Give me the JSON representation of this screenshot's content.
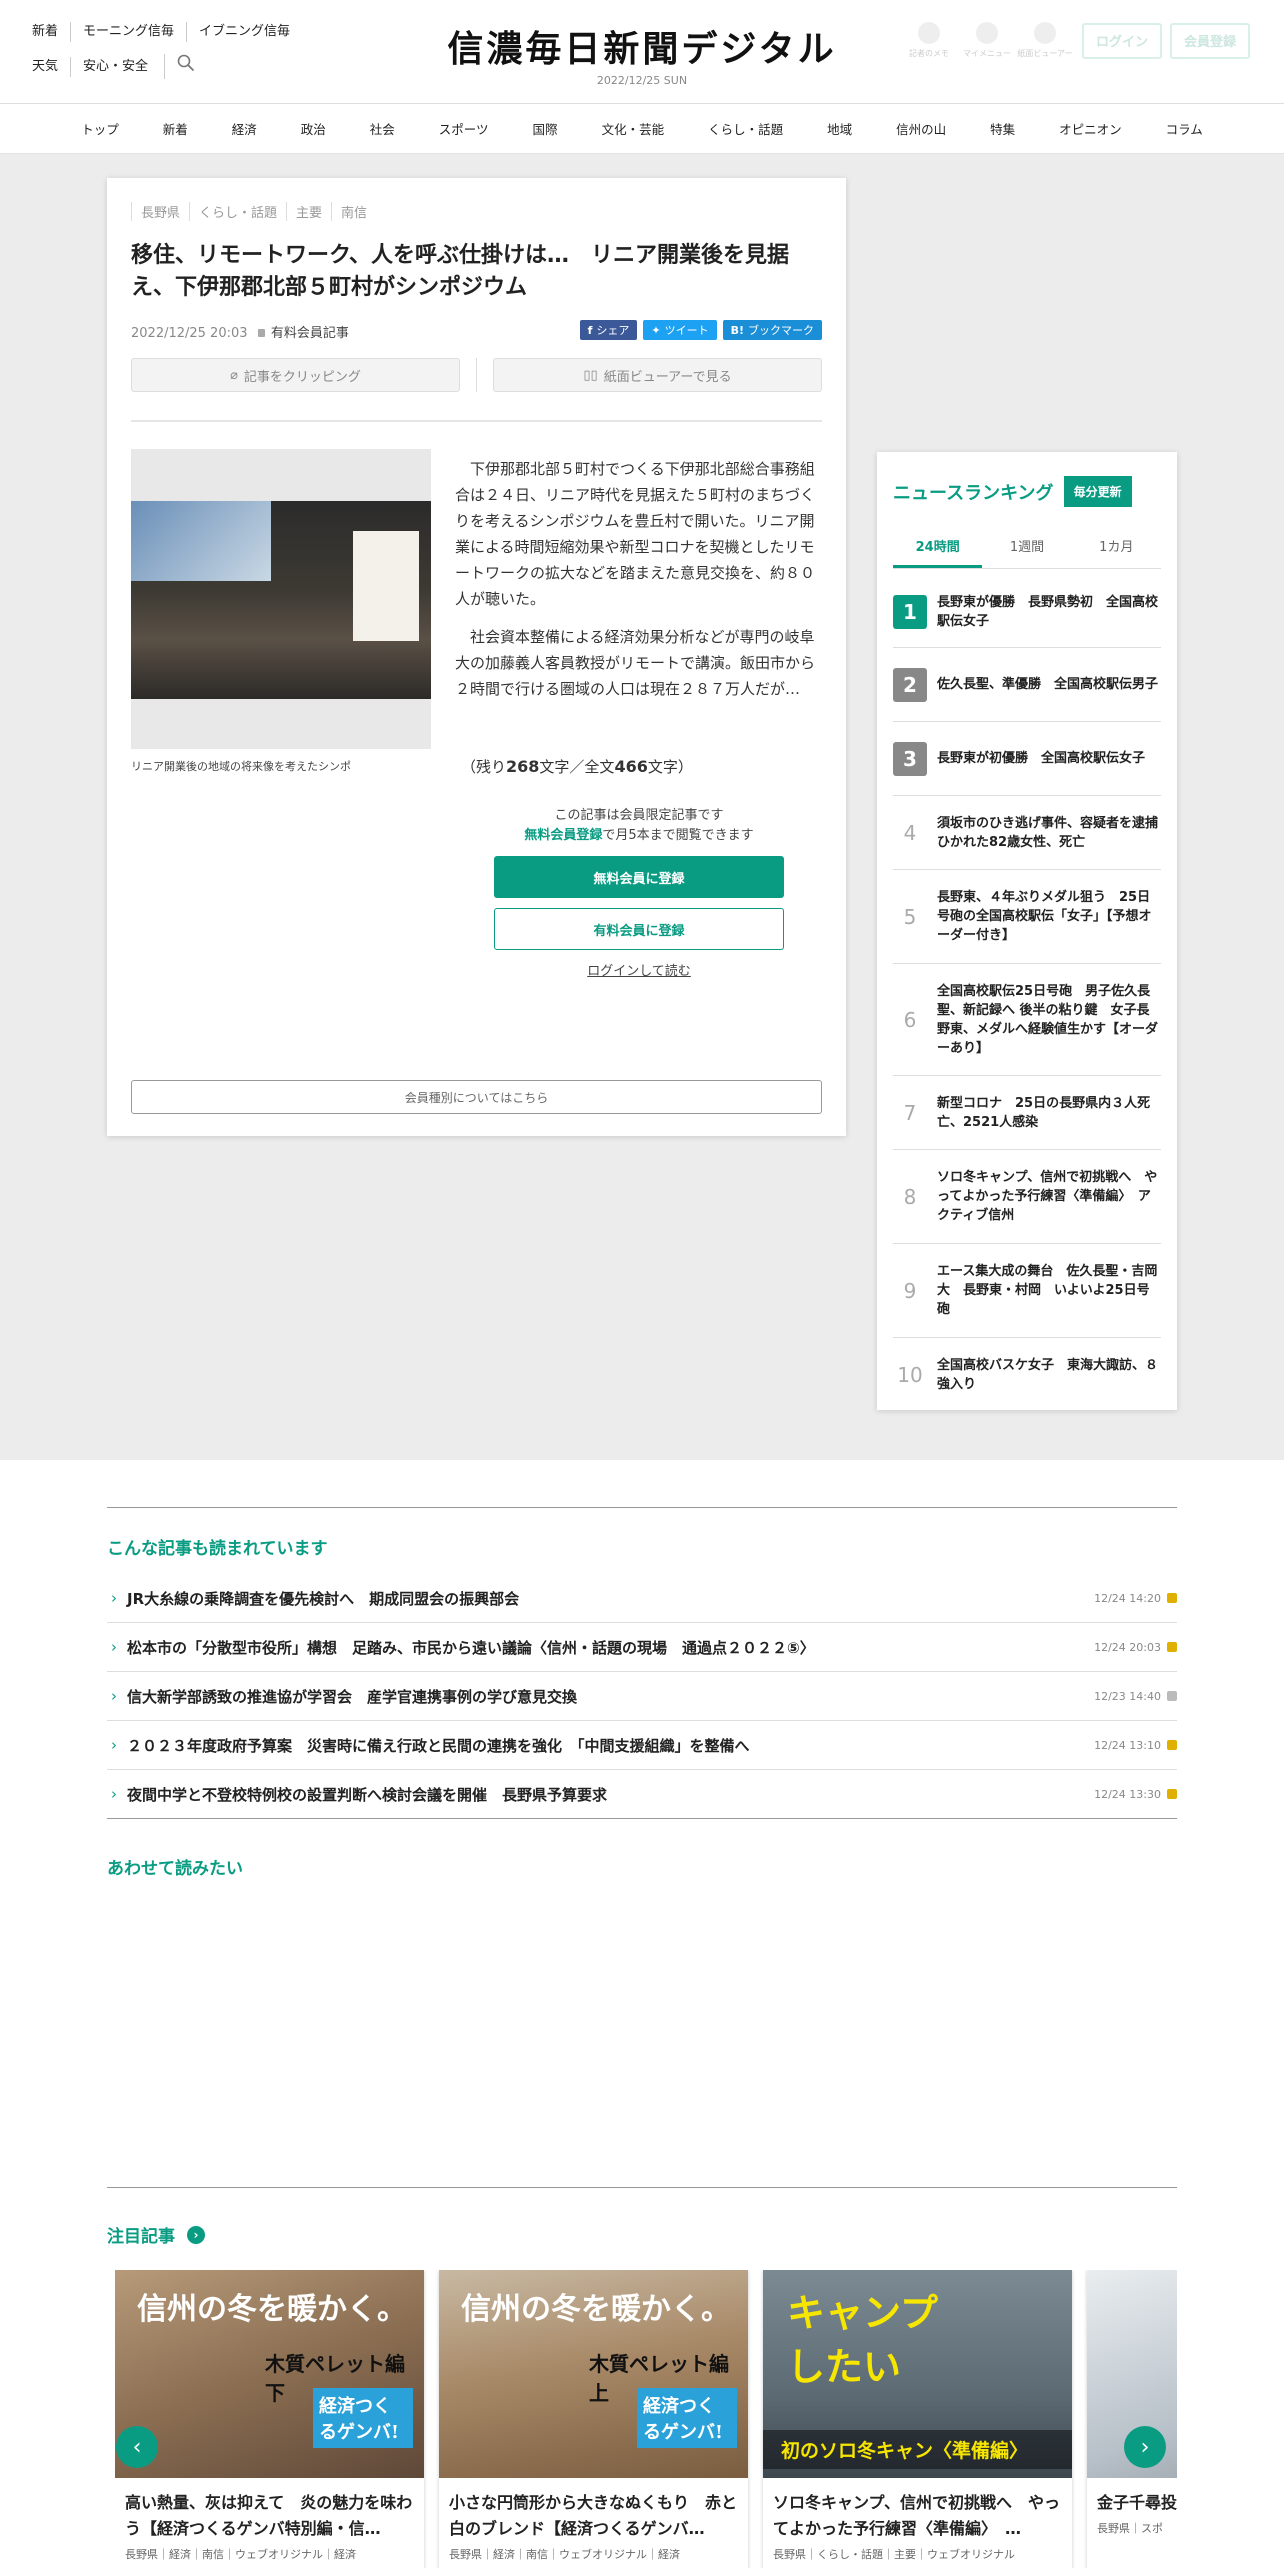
{
  "header": {
    "links_row1": [
      "新着",
      "モーニング信毎",
      "イブニング信毎"
    ],
    "links_row2": [
      "天気",
      "安心・安全"
    ],
    "logo": "信濃毎日新聞デジタル",
    "date": "2022/12/25 SUN",
    "icons": [
      "記者のメモ",
      "マイメニュー",
      "紙面ビューアー"
    ],
    "login": "ログイン",
    "register": "会員登録"
  },
  "nav": [
    "トップ",
    "新着",
    "経済",
    "政治",
    "社会",
    "スポーツ",
    "国際",
    "文化・芸能",
    "くらし・話題",
    "地域",
    "信州の山",
    "特集",
    "オピニオン",
    "コラム"
  ],
  "article": {
    "tags": [
      "長野県",
      "くらし・話題",
      "主要",
      "南信"
    ],
    "title": "移住、リモートワーク、人を呼ぶ仕掛けは…　リニア開業後を見据え、下伊那郡北部５町村がシンポジウム",
    "datetime": "2022/12/25 20:03",
    "paid_label": "有料会員記事",
    "share": "シェア",
    "tweet": "ツイート",
    "bookmark": "ブックマーク",
    "clip": "記事をクリッピング",
    "viewer": "紙面ビューアーで見る",
    "caption": "リニア開業後の地域の将来像を考えたシンポ",
    "p1": "下伊那郡北部５町村でつくる下伊那北部総合事務組合は２４日、リニア時代を見据えた５町村のまちづくりを考えるシンポジウムを豊丘村で開いた。リニア開業による時間短縮効果や新型コロナを契機としたリモートワークの拡大などを踏まえた意見交換を、約８０人が聴いた。",
    "p2": "社会資本整備による経済効果分析などが専門の岐阜大の加藤義人客員教授がリモートで講演。飯田市から２時間で行ける圏域の人口は現在２８７万人だが…",
    "remain_pre": "（残り",
    "remain_n": "268",
    "remain_mid": "文字／全文",
    "total_n": "466",
    "remain_post": "文字）",
    "lock1": "この記事は会員限定記事です",
    "lock2a": "無料会員登録",
    "lock2b": "で月5本まで閲覧できます",
    "btn_free": "無料会員に登録",
    "btn_paid": "有料会員に登録",
    "login_read": "ログインして読む",
    "member_types": "会員種別についてはこちら"
  },
  "ranking": {
    "title": "ニュースランキング",
    "badge": "毎分更新",
    "tabs": [
      "24時間",
      "1週間",
      "1カ月"
    ],
    "items": [
      {
        "n": "1",
        "t": "長野東が優勝　長野県勢初　全国高校駅伝女子"
      },
      {
        "n": "2",
        "t": "佐久長聖、準優勝　全国高校駅伝男子"
      },
      {
        "n": "3",
        "t": "長野東が初優勝　全国高校駅伝女子"
      },
      {
        "n": "4",
        "t": "須坂市のひき逃げ事件、容疑者を逮捕　ひかれた82歳女性、死亡"
      },
      {
        "n": "5",
        "t": "長野東、４年ぶりメダル狙う　25日号砲の全国高校駅伝「女子」【予想オーダー付き】"
      },
      {
        "n": "6",
        "t": "全国高校駅伝25日号砲　男子佐久長聖、新記録へ 後半の粘り鍵　女子長野東、メダルへ経験値生かす【オーダーあり】"
      },
      {
        "n": "7",
        "t": "新型コロナ　25日の長野県内３人死亡、2521人感染"
      },
      {
        "n": "8",
        "t": "ソロ冬キャンプ、信州で初挑戦へ　やってよかった予行練習〈準備編〉　アクティブ信州"
      },
      {
        "n": "9",
        "t": "エース集大成の舞台　佐久長聖・吉岡大　長野東・村岡　いよいよ25日号砲"
      },
      {
        "n": "10",
        "t": "全国高校バスケ女子　東海大諏訪、８強入り"
      }
    ]
  },
  "related": {
    "title": "こんな記事も読まれています",
    "items": [
      {
        "t": "JR大糸線の乗降調査を優先検討へ　期成同盟会の振興部会",
        "time": "12/24 14:20",
        "lock": "#e0b000"
      },
      {
        "t": "松本市の「分散型市役所」構想　足踏み、市民から遠い議論〈信州・話題の現場　通過点２０２２⑤〉",
        "time": "12/24 20:03",
        "lock": "#e0b000"
      },
      {
        "t": "信大新学部誘致の推進協が学習会　産学官連携事例の学び意見交換",
        "time": "12/23 14:40",
        "lock": "#bbbbbb"
      },
      {
        "t": "２０２３年度政府予算案　災害時に備え行政と民間の連携を強化　「中間支援組織」を整備へ",
        "time": "12/24 13:10",
        "lock": "#e0b000"
      },
      {
        "t": "夜間中学と不登校特例校の設置判断へ検討会議を開催　長野県予算要求",
        "time": "12/24 13:30",
        "lock": "#e0b000"
      }
    ]
  },
  "also": {
    "title": "あわせて読みたい"
  },
  "featured": {
    "title": "注目記事",
    "cards": [
      {
        "img1": "信州の冬を暖かく。",
        "img2": "木質ペレット編 下",
        "badge": "経済つくるゲンバ!",
        "t": "高い熱量、灰は抑えて　炎の魅力を味わう【経済つくるゲンバ特別編・信…",
        "tags": "長野県｜経済｜南信｜ウェブオリジナル｜経済"
      },
      {
        "img1": "信州の冬を暖かく。",
        "img2": "木質ペレット編 上",
        "badge": "経済つくるゲンバ!",
        "t": "小さな円筒形から大きなぬくもり　赤と白のブレンド【経済つくるゲンバ…",
        "tags": "長野県｜経済｜南信｜ウェブオリジナル｜経済"
      },
      {
        "img1": "キャンプしたい",
        "img2": "初のソロ冬キャン〈準備編〉",
        "t": "ソロ冬キャンプ、信州で初挑戦へ　やってよかった予行練習〈準備編〉　…",
        "tags": "長野県｜くらし・話題｜主要｜ウェブオリジナル"
      },
      {
        "t": "金子千尋投出、地元長…",
        "tags": "長野県｜スポ"
      }
    ]
  }
}
